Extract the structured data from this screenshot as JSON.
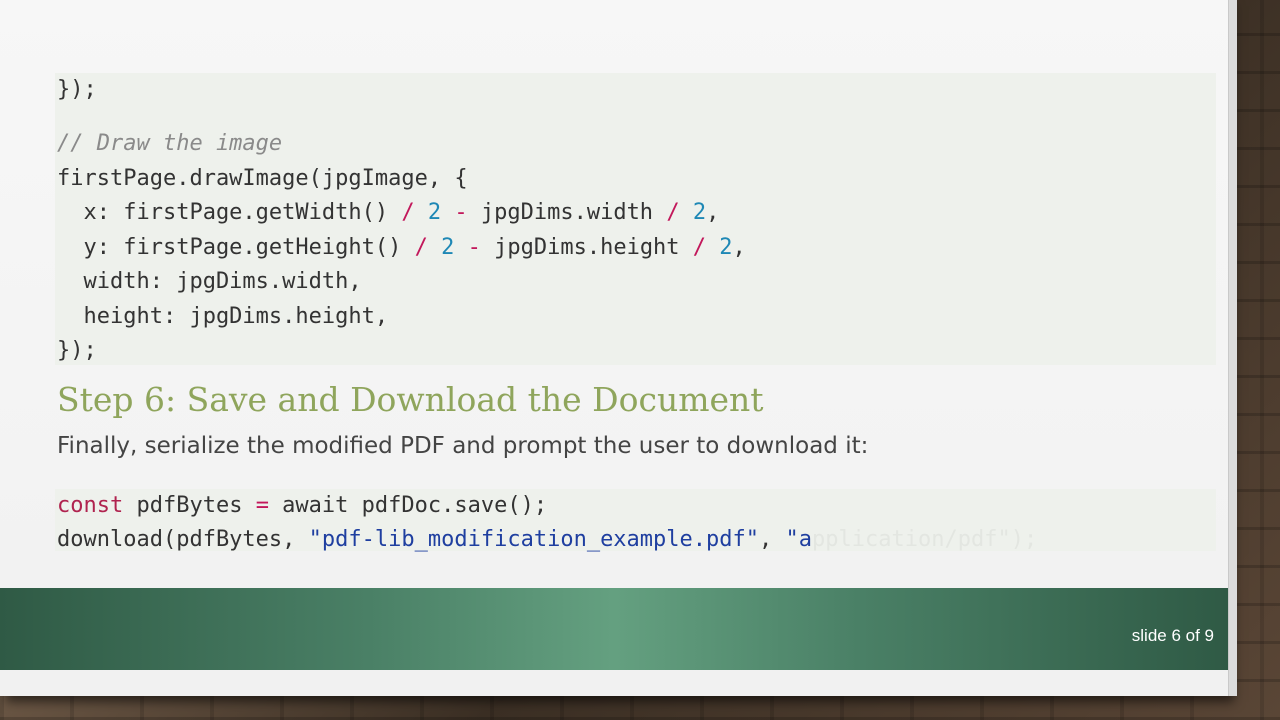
{
  "code_top": {
    "line1_close": "});",
    "comment": "// Draw the image",
    "call_open": "firstPage.drawImage(jpgImage, {",
    "x_key": "  x: firstPage.getWidth() ",
    "x_div1": "/",
    "x_num1": "2",
    "x_minus": "-",
    "x_mid": " jpgDims.width ",
    "x_div2": "/",
    "x_num2": "2",
    "x_end": ",",
    "y_key": "  y: firstPage.getHeight() ",
    "y_div1": "/",
    "y_num1": "2",
    "y_minus": "-",
    "y_mid": " jpgDims.height ",
    "y_div2": "/",
    "y_num2": "2",
    "y_end": ",",
    "width_line": "  width: jpgDims.width,",
    "height_line": "  height: jpgDims.height,",
    "call_close": "});"
  },
  "section": {
    "heading": "Step 6: Save and Download the Document",
    "paragraph": "Finally, serialize the modified PDF and prompt the user to download it:"
  },
  "code_bottom": {
    "kw_const": "const",
    "var_part": " pdfBytes ",
    "eq": "=",
    "rest": " await pdfDoc.save();",
    "dl_start": "download(pdfBytes, ",
    "dl_string": "\"pdf-lib_modification_example.pdf\"",
    "dl_comma": ", ",
    "dl_visible": "\"a",
    "dl_faded": "pplication/pdf\");"
  },
  "footer": {
    "slide_number": "slide 6 of 9"
  },
  "colors": {
    "heading": "#8fa55c",
    "footer_band": "#4a8066",
    "code_bg": "#eef1ec"
  }
}
